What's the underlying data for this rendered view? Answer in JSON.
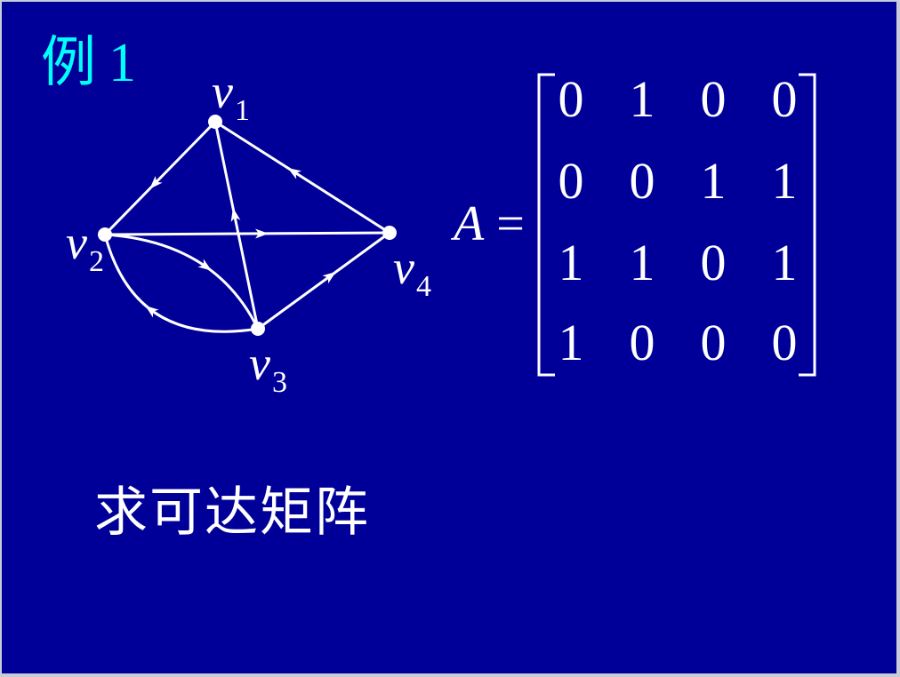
{
  "title": {
    "prefix": "例",
    "number": "1"
  },
  "graph": {
    "nodes": [
      {
        "id": "v1",
        "letter": "v",
        "index": "1"
      },
      {
        "id": "v2",
        "letter": "v",
        "index": "2"
      },
      {
        "id": "v3",
        "letter": "v",
        "index": "3"
      },
      {
        "id": "v4",
        "letter": "v",
        "index": "4"
      }
    ],
    "edges": [
      {
        "from": "v1",
        "to": "v2"
      },
      {
        "from": "v2",
        "to": "v4"
      },
      {
        "from": "v2",
        "to": "v3"
      },
      {
        "from": "v3",
        "to": "v1"
      },
      {
        "from": "v3",
        "to": "v2"
      },
      {
        "from": "v3",
        "to": "v4"
      },
      {
        "from": "v4",
        "to": "v1"
      }
    ]
  },
  "matrix": {
    "symbol": "A",
    "equals": "=",
    "rows": [
      [
        "0",
        "1",
        "0",
        "0"
      ],
      [
        "0",
        "0",
        "1",
        "1"
      ],
      [
        "1",
        "1",
        "0",
        "1"
      ],
      [
        "1",
        "0",
        "0",
        "0"
      ]
    ]
  },
  "colors": {
    "background": "#000099",
    "title": "#00ffff",
    "foreground": "#ffffff"
  },
  "caption": "求可达矩阵"
}
